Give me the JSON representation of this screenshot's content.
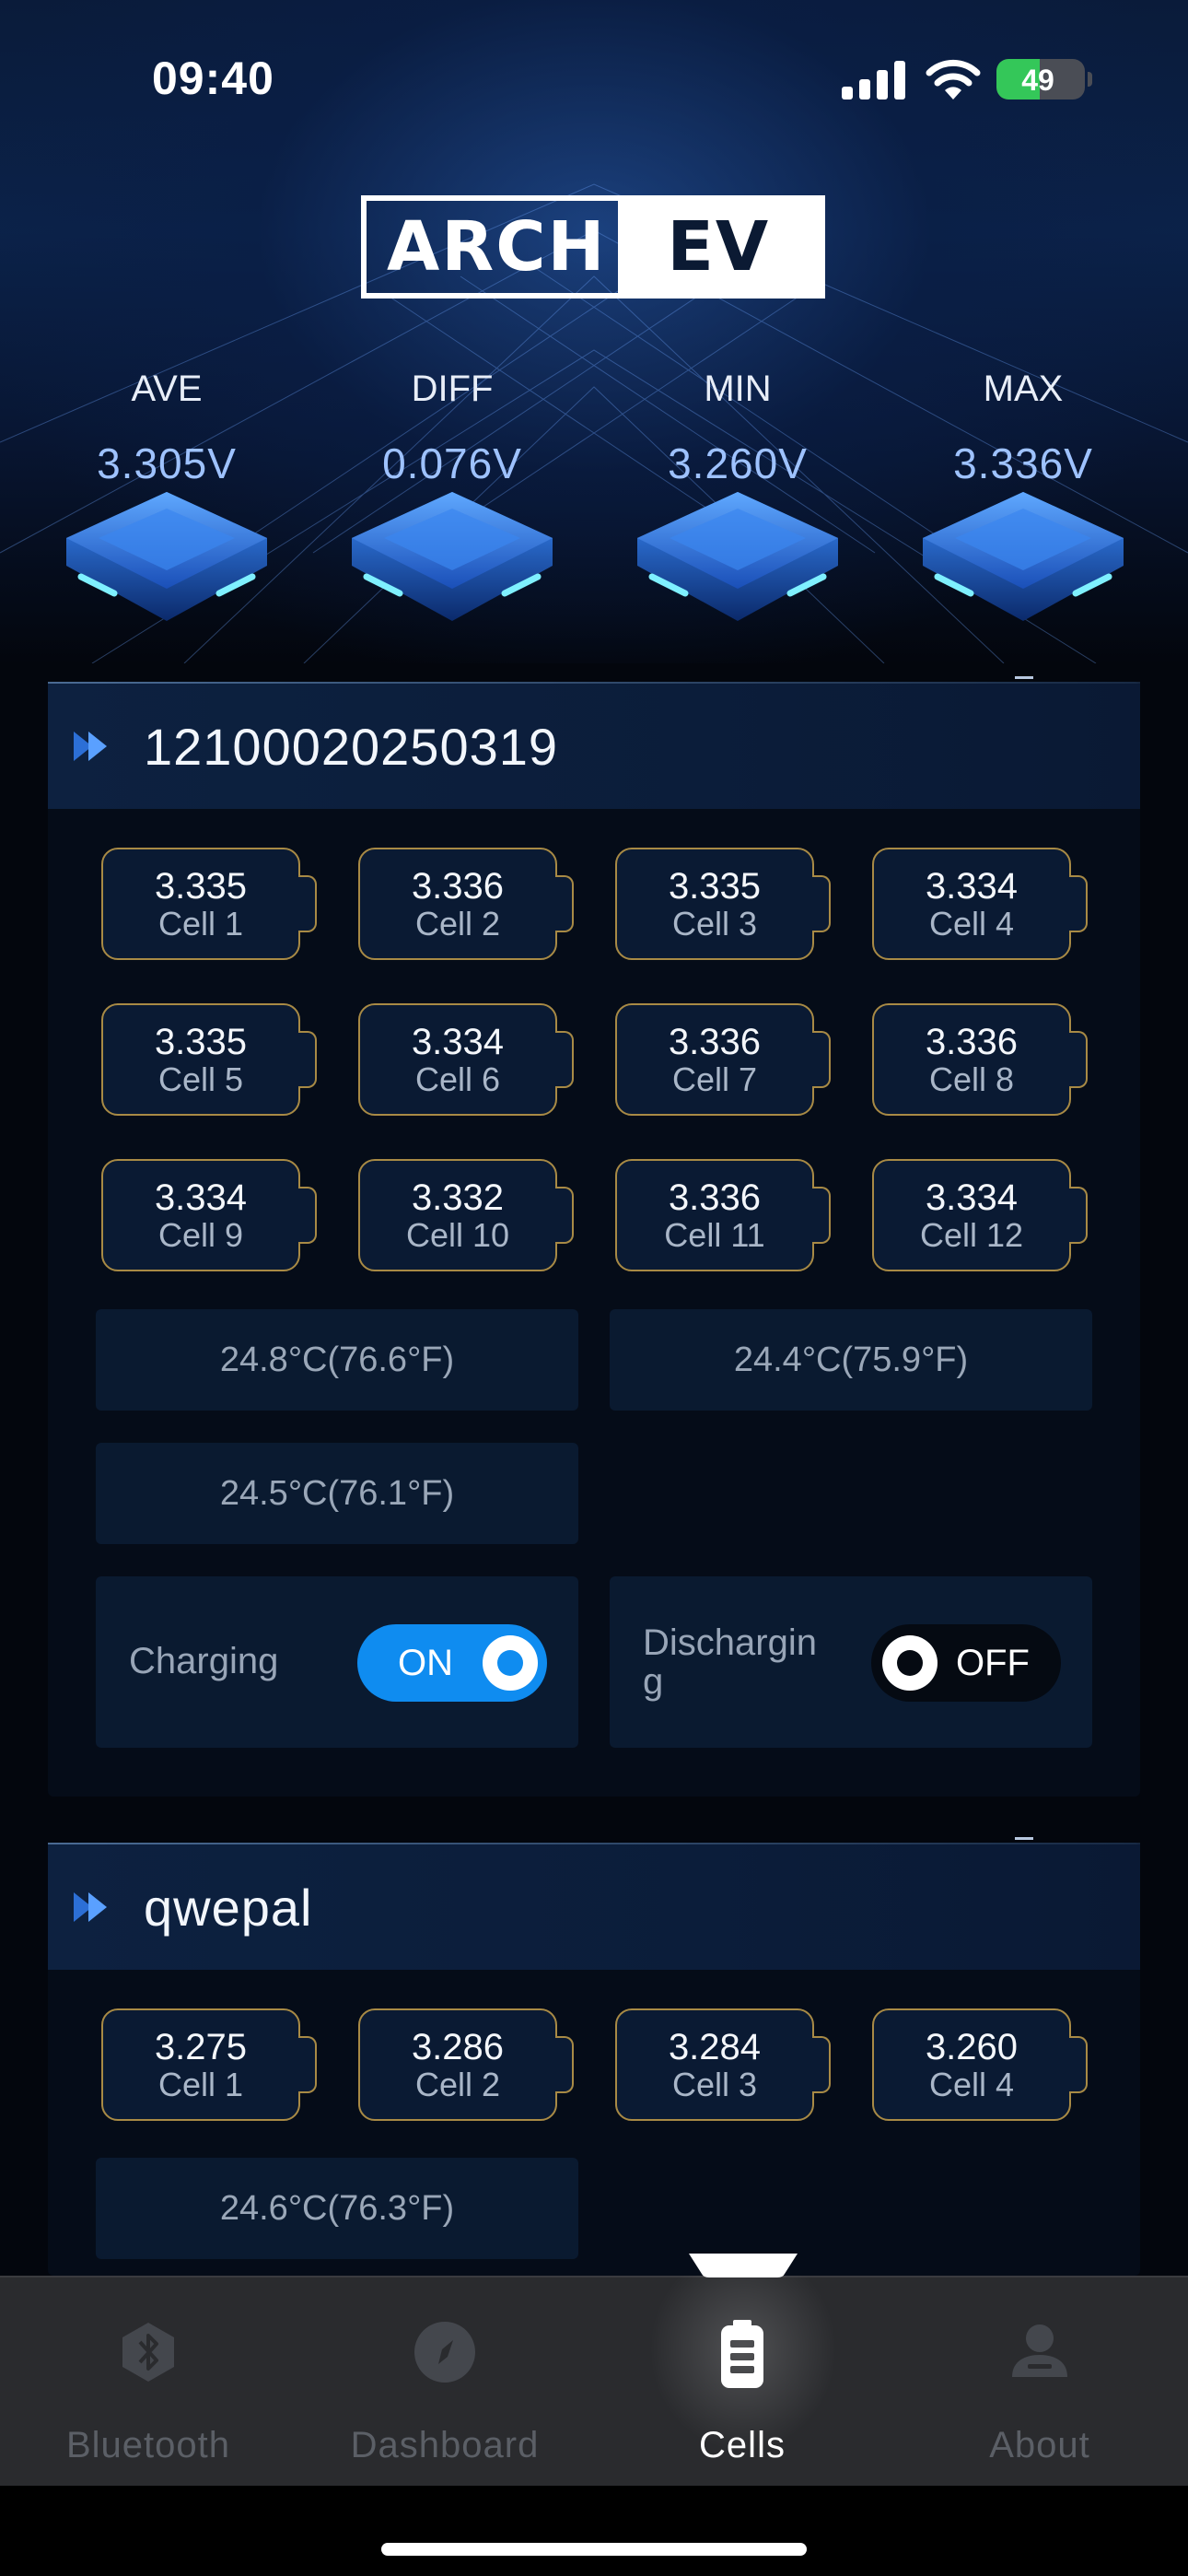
{
  "status_bar": {
    "time": "09:40",
    "battery": "49",
    "battery_level": 0.49
  },
  "brand": {
    "left": "ARCH",
    "right": "EV"
  },
  "stats": [
    {
      "label": "AVE",
      "value": "3.305V"
    },
    {
      "label": "DIFF",
      "value": "0.076V"
    },
    {
      "label": "MIN",
      "value": "3.260V"
    },
    {
      "label": "MAX",
      "value": "3.336V"
    }
  ],
  "packs": [
    {
      "name": "12100020250319",
      "cells": [
        {
          "value": "3.335",
          "name": "Cell 1"
        },
        {
          "value": "3.336",
          "name": "Cell 2"
        },
        {
          "value": "3.335",
          "name": "Cell 3"
        },
        {
          "value": "3.334",
          "name": "Cell 4"
        },
        {
          "value": "3.335",
          "name": "Cell 5"
        },
        {
          "value": "3.334",
          "name": "Cell 6"
        },
        {
          "value": "3.336",
          "name": "Cell 7"
        },
        {
          "value": "3.336",
          "name": "Cell 8"
        },
        {
          "value": "3.334",
          "name": "Cell 9"
        },
        {
          "value": "3.332",
          "name": "Cell 10"
        },
        {
          "value": "3.336",
          "name": "Cell 11"
        },
        {
          "value": "3.334",
          "name": "Cell 12"
        }
      ],
      "temps": [
        "24.8°C(76.6°F)",
        "24.4°C(75.9°F)",
        "24.5°C(76.1°F)"
      ],
      "charging": {
        "label": "Charging",
        "state": "ON"
      },
      "discharging": {
        "label_line1": "Dischargin",
        "label_line2": "g",
        "state": "OFF"
      }
    },
    {
      "name": "qwepal",
      "cells": [
        {
          "value": "3.275",
          "name": "Cell 1"
        },
        {
          "value": "3.286",
          "name": "Cell 2"
        },
        {
          "value": "3.284",
          "name": "Cell 3"
        },
        {
          "value": "3.260",
          "name": "Cell 4"
        }
      ],
      "temps": [
        "24.6°C(76.3°F)"
      ]
    }
  ],
  "tabs": [
    {
      "label": "Bluetooth",
      "icon": "bluetooth-icon",
      "active": false
    },
    {
      "label": "Dashboard",
      "icon": "compass-icon",
      "active": false
    },
    {
      "label": "Cells",
      "icon": "battery-icon",
      "active": true
    },
    {
      "label": "About",
      "icon": "person-icon",
      "active": false
    }
  ],
  "colors": {
    "accent": "#0f8cf0",
    "cell_border": "#a88a45",
    "stat_value": "#9ec2ff"
  }
}
